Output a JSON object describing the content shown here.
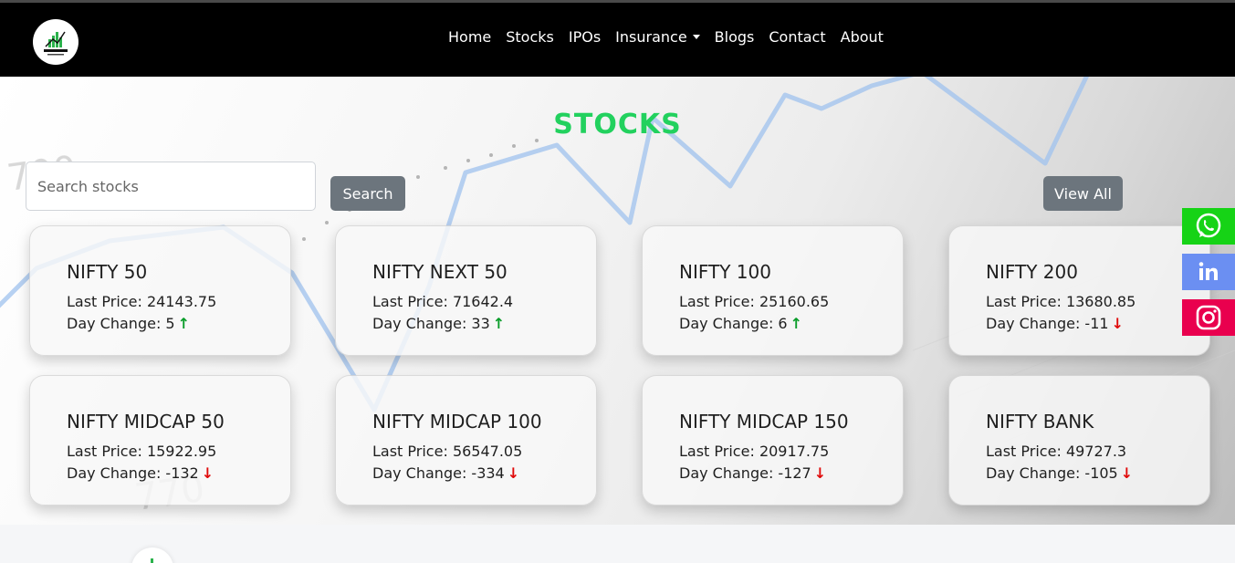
{
  "nav": {
    "items": [
      "Home",
      "Stocks",
      "IPOs",
      "Insurance",
      "Blogs",
      "Contact",
      "About"
    ]
  },
  "title": "STOCKS",
  "search": {
    "placeholder": "Search stocks",
    "button": "Search"
  },
  "view_all": "View All",
  "price_label": "Last Price:",
  "change_label": "Day Change:",
  "cards": [
    {
      "name": "NIFTY 50",
      "price": "24143.75",
      "change": "5",
      "direction": "up"
    },
    {
      "name": "NIFTY NEXT 50",
      "price": "71642.4",
      "change": "33",
      "direction": "up"
    },
    {
      "name": "NIFTY 100",
      "price": "25160.65",
      "change": "6",
      "direction": "up"
    },
    {
      "name": "NIFTY 200",
      "price": "13680.85",
      "change": "-11",
      "direction": "down"
    },
    {
      "name": "NIFTY MIDCAP 50",
      "price": "15922.95",
      "change": "-132",
      "direction": "down"
    },
    {
      "name": "NIFTY MIDCAP 100",
      "price": "56547.05",
      "change": "-334",
      "direction": "down"
    },
    {
      "name": "NIFTY MIDCAP 150",
      "price": "20917.75",
      "change": "-127",
      "direction": "down"
    },
    {
      "name": "NIFTY BANK",
      "price": "49727.3",
      "change": "-105",
      "direction": "down"
    }
  ],
  "social": [
    {
      "icon": "whatsapp-icon",
      "color": "#16d316"
    },
    {
      "icon": "linkedin-icon",
      "color": "#6b8ff2"
    },
    {
      "icon": "instagram-icon",
      "color": "#e9004e"
    }
  ],
  "colors": {
    "accent": "#22d15e",
    "up": "#0a9d2a",
    "down": "#e00a0a"
  }
}
